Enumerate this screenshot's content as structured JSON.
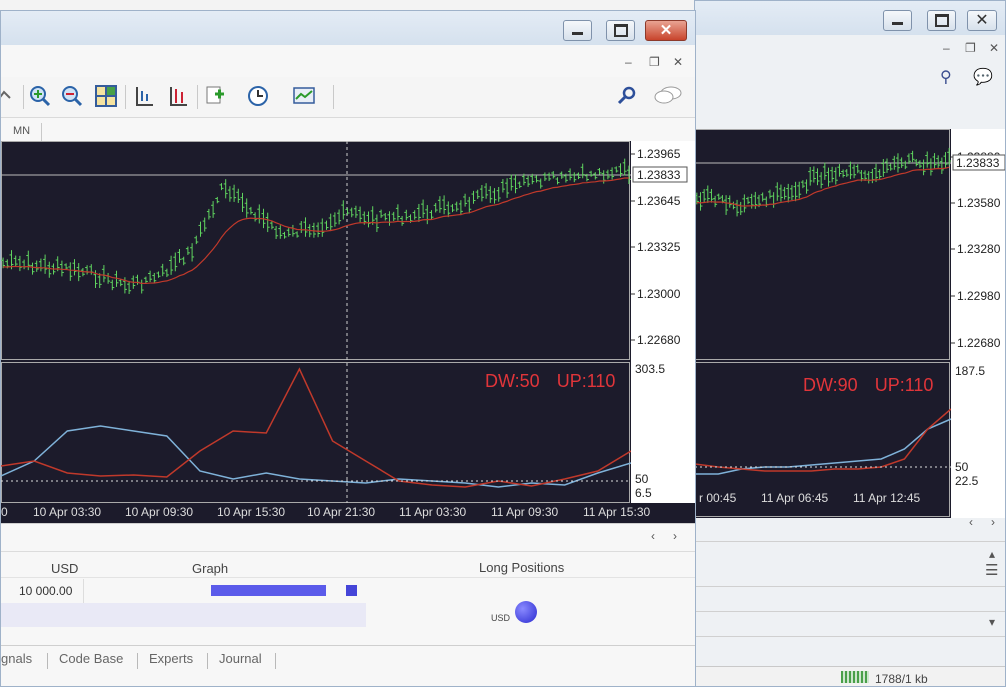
{
  "front": {
    "toolbar_icons": [
      "line-tool-icon",
      "zoom-in-icon",
      "zoom-out-icon",
      "tile-windows-icon",
      "period-separator-icon",
      "price-scale-icon",
      "add-indicator-icon",
      "clock-icon",
      "chart-template-icon"
    ],
    "timeframe": "MN",
    "price_axis": {
      "ticks": [
        "1.23965",
        "1.23645",
        "1.23325",
        "1.23000",
        "1.22680"
      ],
      "current": "1.23833"
    },
    "indicator_axis": {
      "max": "303.5",
      "level": "50",
      "min": "6.5"
    },
    "indicator_label": {
      "dw": "DW:50",
      "up": "UP:110"
    },
    "time_axis": [
      "0",
      "10 Apr 03:30",
      "10 Apr 09:30",
      "10 Apr 15:30",
      "10 Apr 21:30",
      "11 Apr 03:30",
      "11 Apr 09:30",
      "11 Apr 15:30"
    ],
    "table": {
      "col_currency": "USD",
      "col_graph": "Graph",
      "col_long": "Long Positions",
      "value": "10 000.00",
      "bubble_label": "USD"
    },
    "tabs": [
      "gnals",
      "Code Base",
      "Experts",
      "Journal"
    ]
  },
  "back": {
    "price_axis": {
      "ticks": [
        "1.23880",
        "1.23580",
        "1.23280",
        "1.22980",
        "1.22680"
      ],
      "current": "1.23833"
    },
    "indicator_axis": {
      "max": "187.5",
      "level": "50",
      "min": "22.5"
    },
    "indicator_label": {
      "dw": "DW:90",
      "up": "UP:110"
    },
    "time_axis": [
      "r 00:45",
      "11 Apr 06:45",
      "11 Apr 12:45"
    ],
    "status": "1788/1 kb"
  },
  "colors": {
    "chart_bg": "#1c1b2b",
    "candle": "#5fd35f",
    "ma": "#c0392b",
    "ind_blue": "#7fb2d9",
    "ind_red": "#c0392b",
    "label_red": "#e0353a",
    "bar_blue": "#5b5bea"
  }
}
